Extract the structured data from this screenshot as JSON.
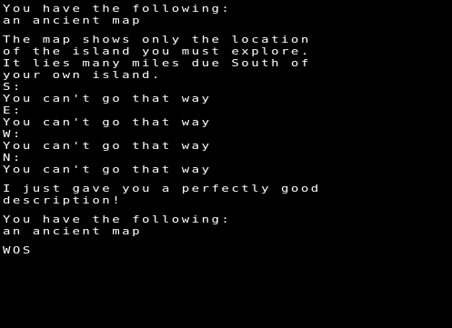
{
  "screen": {
    "background": "#000000",
    "text_color": "#FFFFFF",
    "lines": [
      "You have the following:",
      "an ancient map",
      "",
      "The map shows only the location",
      "of the island you must explore.",
      "It lies many miles due South of",
      "your own island.",
      "S:",
      "You can't go that way",
      "E:",
      "You can't go that way",
      "W:",
      "You can't go that way",
      "N:",
      "You can't go that way",
      "",
      "I just gave you a perfectly good",
      "description!",
      "",
      "You have the following:",
      "an ancient map",
      ""
    ],
    "input": "WOS"
  }
}
